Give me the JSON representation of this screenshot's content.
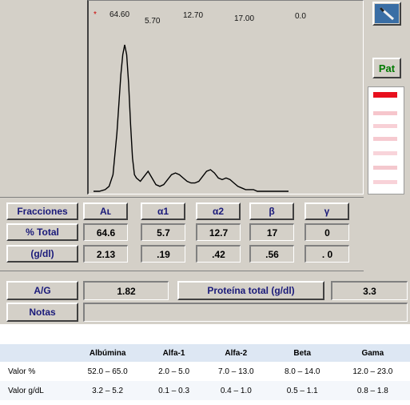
{
  "chart_data": {
    "type": "line",
    "title": "",
    "xlabel": "",
    "ylabel": "",
    "peak_marker": "*",
    "peak_labels": [
      "64.60",
      "5.70",
      "12.70",
      "17.00",
      "0.0"
    ],
    "x": [
      0,
      3,
      6,
      8,
      10,
      12,
      14,
      15,
      16,
      17,
      18,
      19,
      20,
      21,
      22,
      24,
      26,
      28,
      30,
      32,
      34,
      36,
      38,
      40,
      42,
      44,
      46,
      48,
      50,
      52,
      54,
      56,
      58,
      60,
      62,
      64,
      66,
      68,
      70,
      72,
      74,
      76,
      78,
      80,
      82,
      84,
      86,
      88,
      90,
      92,
      94,
      96,
      98,
      100
    ],
    "y": [
      0,
      0,
      1,
      3,
      10,
      35,
      70,
      82,
      88,
      82,
      65,
      40,
      20,
      10,
      8,
      6,
      9,
      12,
      8,
      4,
      3,
      4,
      7,
      10,
      11,
      10,
      8,
      6,
      5,
      5,
      6,
      9,
      12,
      13,
      11,
      8,
      7,
      8,
      7,
      5,
      3,
      2,
      1,
      1,
      1,
      0,
      0,
      0,
      0,
      0,
      0,
      0,
      0,
      0
    ],
    "xlim": [
      0,
      100
    ],
    "ylim": [
      0,
      100
    ],
    "grid": false
  },
  "colors": {
    "panel": "#d4d0c8",
    "trace": "#000000",
    "header_text": "#1a1a7a",
    "pat_text": "#007a00",
    "table_header_bg": "#dde7f3"
  },
  "icons": {
    "wand": "magic-wand-icon"
  },
  "toolbar": {
    "pat_label": "Pat"
  },
  "bands": [
    "#e8101e",
    "#f6c6cc",
    "#f8d0d6",
    "#f6cad0",
    "#f8d4da",
    "#f4c8ce",
    "#f8d2d8"
  ],
  "fractions": {
    "row_label": "Fracciones",
    "names": [
      "Aʟ",
      "α1",
      "α2",
      "β",
      "γ"
    ],
    "pct_label": "% Total",
    "pct_values": [
      "64.6",
      "5.7",
      "12.7",
      "17",
      "0"
    ],
    "gdl_label": "(g/dl)",
    "gdl_values": [
      "2.13",
      ".19",
      ".42",
      ".56",
      ". 0"
    ]
  },
  "ag": {
    "label": "A/G",
    "value": "1.82"
  },
  "protein": {
    "label": "Proteína total (g/dl)",
    "value": "3.3"
  },
  "notes": {
    "label": "Notas",
    "value": ""
  },
  "reference": {
    "headers": [
      "",
      "Albúmina",
      "Alfa-1",
      "Alfa-2",
      "Beta",
      "Gama"
    ],
    "rows": [
      [
        "Valor %",
        "52.0 – 65.0",
        "2.0 – 5.0",
        "7.0 – 13.0",
        "8.0 – 14.0",
        "12.0 – 23.0"
      ],
      [
        "Valor g/dL",
        "3.2 – 5.2",
        "0.1 – 0.3",
        "0.4 – 1.0",
        "0.5 – 1.1",
        "0.8 – 1.8"
      ]
    ]
  }
}
